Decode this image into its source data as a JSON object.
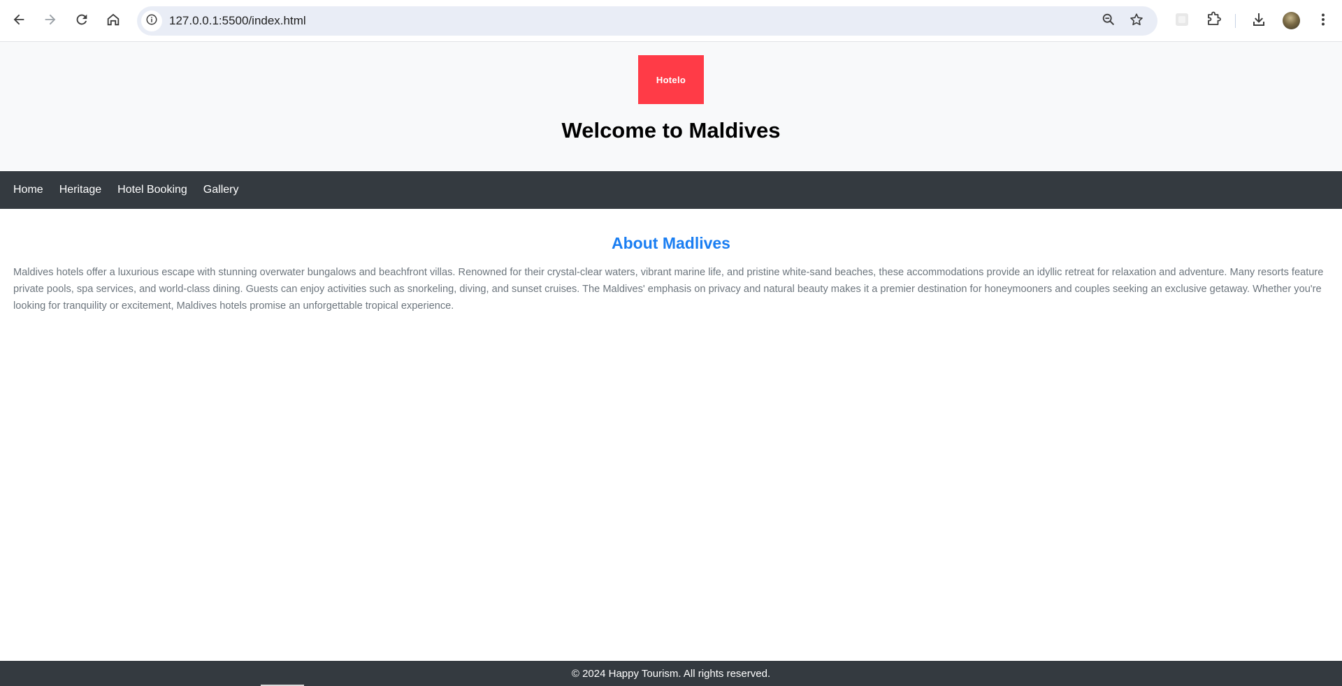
{
  "browser": {
    "url": "127.0.0.1:5500/index.html",
    "icons": {
      "back": "arrow-left-icon",
      "forward": "arrow-right-icon",
      "reload": "reload-icon",
      "home": "home-icon",
      "site_info": "info-icon",
      "zoom": "zoom-out-icon",
      "bookmark": "star-icon",
      "extension_blank": "extension-tile-icon",
      "extensions": "puzzle-icon",
      "downloads": "download-icon",
      "menu": "kebab-menu-icon"
    }
  },
  "header": {
    "logo_text": "Hotelo",
    "title": "Welcome to Maldives",
    "logo_color": "#ff3b47",
    "background": "#f8f9fa"
  },
  "nav": {
    "items": [
      {
        "label": "Home"
      },
      {
        "label": "Heritage"
      },
      {
        "label": "Hotel Booking"
      },
      {
        "label": "Gallery"
      }
    ],
    "background": "#343a40"
  },
  "about": {
    "title": "About Madlives",
    "text": "Maldives hotels offer a luxurious escape with stunning overwater bungalows and beachfront villas. Renowned for their crystal-clear waters, vibrant marine life, and pristine white-sand beaches, these accommodations provide an idyllic retreat for relaxation and adventure. Many resorts feature private pools, spa services, and world-class dining. Guests can enjoy activities such as snorkeling, diving, and sunset cruises. The Maldives' emphasis on privacy and natural beauty makes it a premier destination for honeymooners and couples seeking an exclusive getaway. Whether you're looking for tranquility or excitement, Maldives hotels promise an unforgettable tropical experience.",
    "title_color": "#1a7ef2"
  },
  "footer": {
    "text": "© 2024 Happy Tourism. All rights reserved."
  }
}
